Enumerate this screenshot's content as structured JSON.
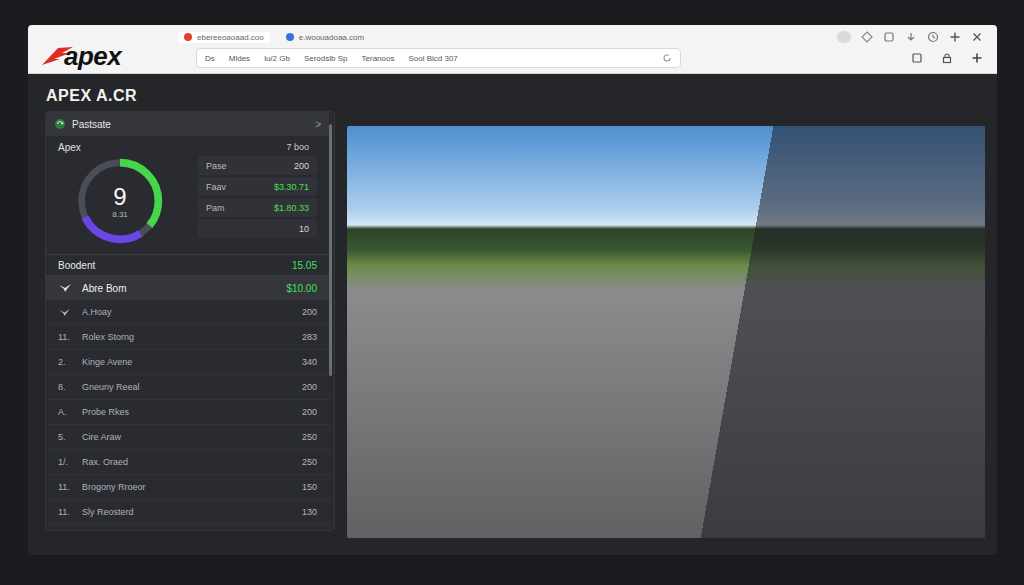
{
  "browser": {
    "tabs": [
      {
        "label": "ebereeoaoaad.coo",
        "selected": true,
        "color": "#e0412f"
      },
      {
        "label": "e.woouadoaa.com",
        "selected": false,
        "color": "#3b6fd8"
      }
    ],
    "address_items": [
      "Ds",
      "Mldes",
      "lu/2 Gb",
      "Serodslb Sp",
      "Teranoos",
      "Sool Bicd 307"
    ]
  },
  "logo": "apex",
  "page_title": "APEX A.CR",
  "panel": {
    "header": "Pastsate",
    "chevron": ">",
    "gauge": {
      "label": "Apex",
      "value": "9",
      "sub": "8.31",
      "segments": [
        {
          "level": 0.36,
          "color": "#45d64a"
        },
        {
          "level": 0.27,
          "color": "#6a45e8"
        }
      ]
    },
    "stats_header": "7 boo",
    "stats": [
      {
        "label": "Pase",
        "value": "200",
        "accent": false
      },
      {
        "label": "Faav",
        "value": "$3.30.71",
        "accent": true
      },
      {
        "label": "Pam",
        "value": "$1.80.33",
        "accent": true
      },
      {
        "value": "10",
        "accent": false
      }
    ],
    "summary": {
      "label": "Boodent",
      "value": "15.05",
      "accent": true
    },
    "featured": {
      "label": "Abre Bom",
      "value": "$10.00",
      "accent": true,
      "selected": true
    },
    "rows": [
      {
        "kind": "icon",
        "name": "A.Hoay",
        "value": "200"
      },
      {
        "kind": "rank",
        "rank": "11.",
        "name": "Rolex Storng",
        "value": "283"
      },
      {
        "kind": "rank",
        "rank": "2.",
        "name": "Kinge Avene",
        "value": "340"
      },
      {
        "kind": "rank",
        "rank": "8.",
        "name": "Gneuny Reeal",
        "value": "200"
      },
      {
        "kind": "rank",
        "rank": "A.",
        "name": "Probe Rkes",
        "value": "200"
      },
      {
        "kind": "rank",
        "rank": "5.",
        "name": "Cire Araw",
        "value": "250"
      },
      {
        "kind": "rank",
        "rank": "1/.",
        "name": "Rax. Oraed",
        "value": "250"
      },
      {
        "kind": "rank",
        "rank": "11.",
        "name": "Brogony Rroeor",
        "value": "150"
      },
      {
        "kind": "rank",
        "rank": "11.",
        "name": "Sly Reosterd",
        "value": "130"
      }
    ],
    "scrollbar": {
      "level": 0.62
    }
  }
}
